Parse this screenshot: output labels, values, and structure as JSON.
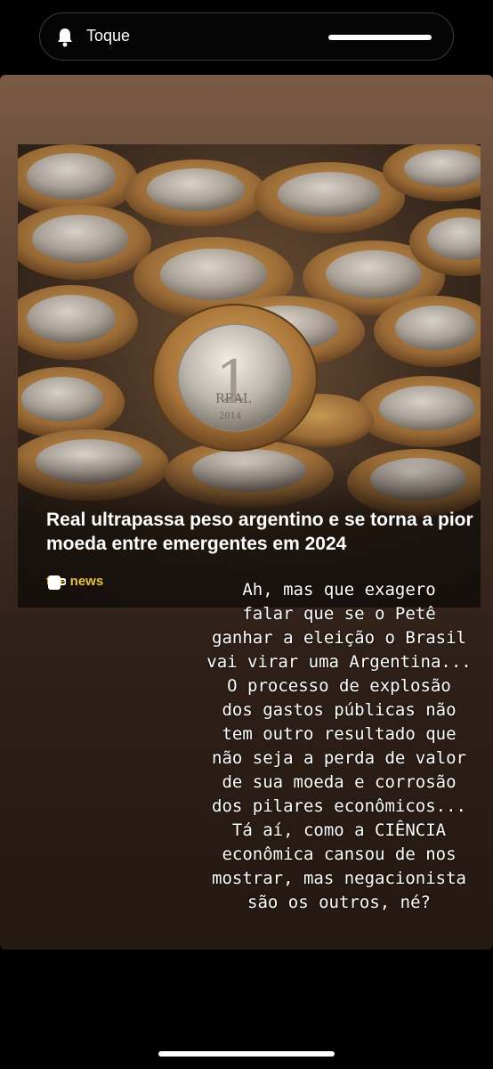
{
  "notification": {
    "label": "Toque",
    "icon": "bell-icon"
  },
  "post": {
    "headline": "Real ultrapassa peso argentino e se torna a pior moeda entre emergentes em 2024",
    "brand": "the news",
    "brand_color": "#e6c23c",
    "coin": {
      "denomination": "1",
      "word": "REAL",
      "year": "2014"
    }
  },
  "caption": "Ah, mas que exagero\nfalar que se o Petê\nganhar a eleição o Brasil\nvai virar uma Argentina...\nO processo de explosão\ndos gastos públicas não\ntem outro resultado que\nnão seja a perda de valor\nde sua moeda e corrosão\ndos pilares econômicos...\nTá aí, como a CIÊNCIA\neconômica cansou de nos\nmostrar, mas negacionista\nsão os outros, né?"
}
